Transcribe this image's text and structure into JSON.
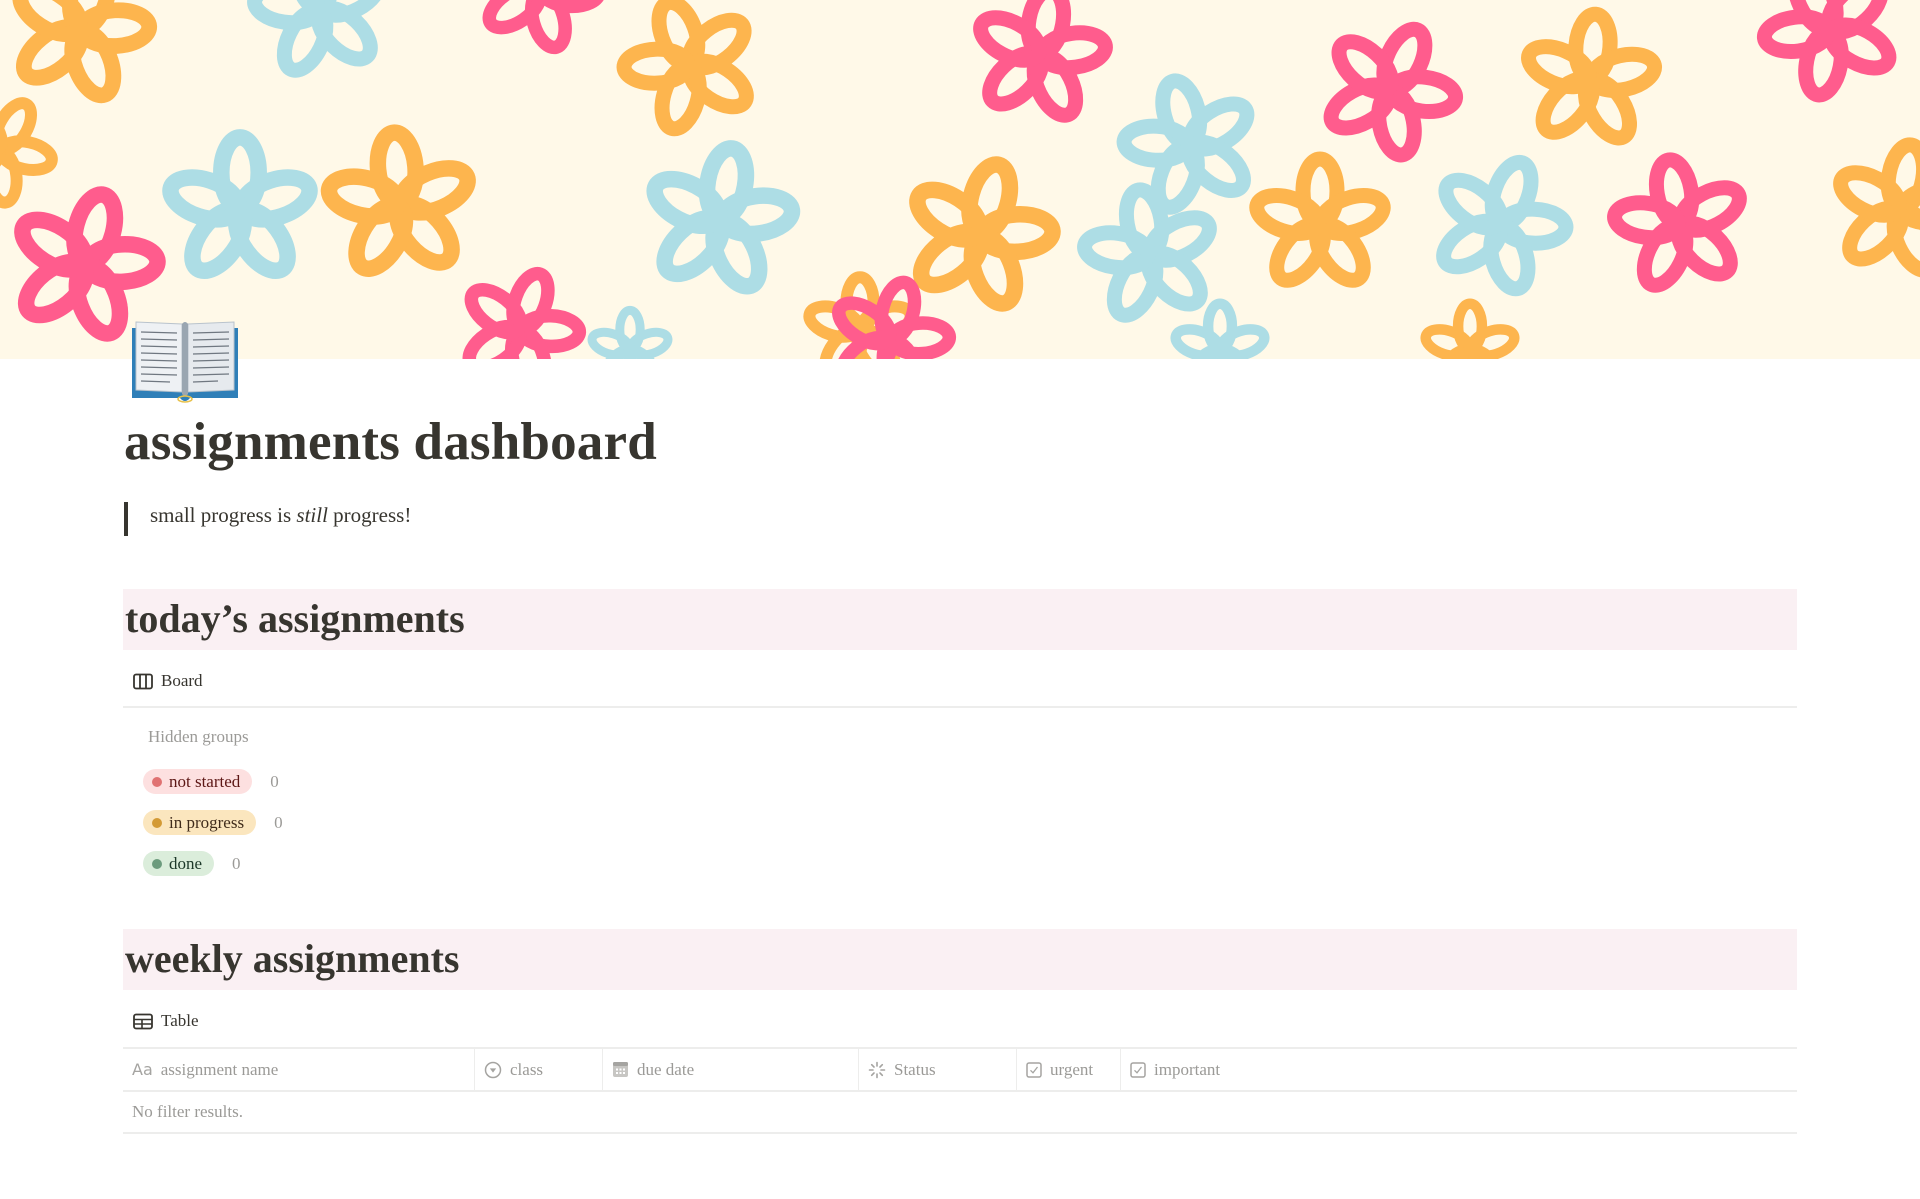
{
  "page": {
    "icon": "open-book-emoji",
    "title": "assignments dashboard",
    "quote": {
      "before": "small progress is ",
      "emphasis": "still",
      "after": " progress!"
    }
  },
  "banner": {
    "pattern": "flowers",
    "colors": {
      "background": "#FFF9E8",
      "orange": "#FDB54E",
      "blue": "#ADDDE5",
      "pink": "#FF5C8D"
    }
  },
  "sections": {
    "today": {
      "title": "today’s assignments",
      "view_tab": {
        "icon": "board-icon",
        "label": "Board"
      },
      "hidden_groups_label": "Hidden groups",
      "groups": [
        {
          "label": "not started",
          "count": "0",
          "bg": "#FDE0E0",
          "dot": "#E07272",
          "text": "#5D1715"
        },
        {
          "label": "in progress",
          "count": "0",
          "bg": "#FBE6BE",
          "dot": "#D39A35",
          "text": "#402C1B"
        },
        {
          "label": "done",
          "count": "0",
          "bg": "#DBEDDB",
          "dot": "#6C9B7D",
          "text": "#1C3829"
        }
      ]
    },
    "weekly": {
      "title": "weekly assignments",
      "view_tab": {
        "icon": "table-icon",
        "label": "Table"
      },
      "columns": [
        {
          "icon": "text-property-icon",
          "icon_glyph": "Aa",
          "label": "assignment name"
        },
        {
          "icon": "select-property-icon",
          "label": "class"
        },
        {
          "icon": "calendar-icon",
          "label": "due date"
        },
        {
          "icon": "status-icon",
          "label": "Status"
        },
        {
          "icon": "checkbox-icon",
          "label": "urgent"
        },
        {
          "icon": "checkbox-icon",
          "label": "important"
        }
      ],
      "empty_message": "No filter results."
    }
  },
  "colors": {
    "section_band": "#FAF0F3",
    "text": "#37352f",
    "muted_text": "#9b9a97"
  }
}
